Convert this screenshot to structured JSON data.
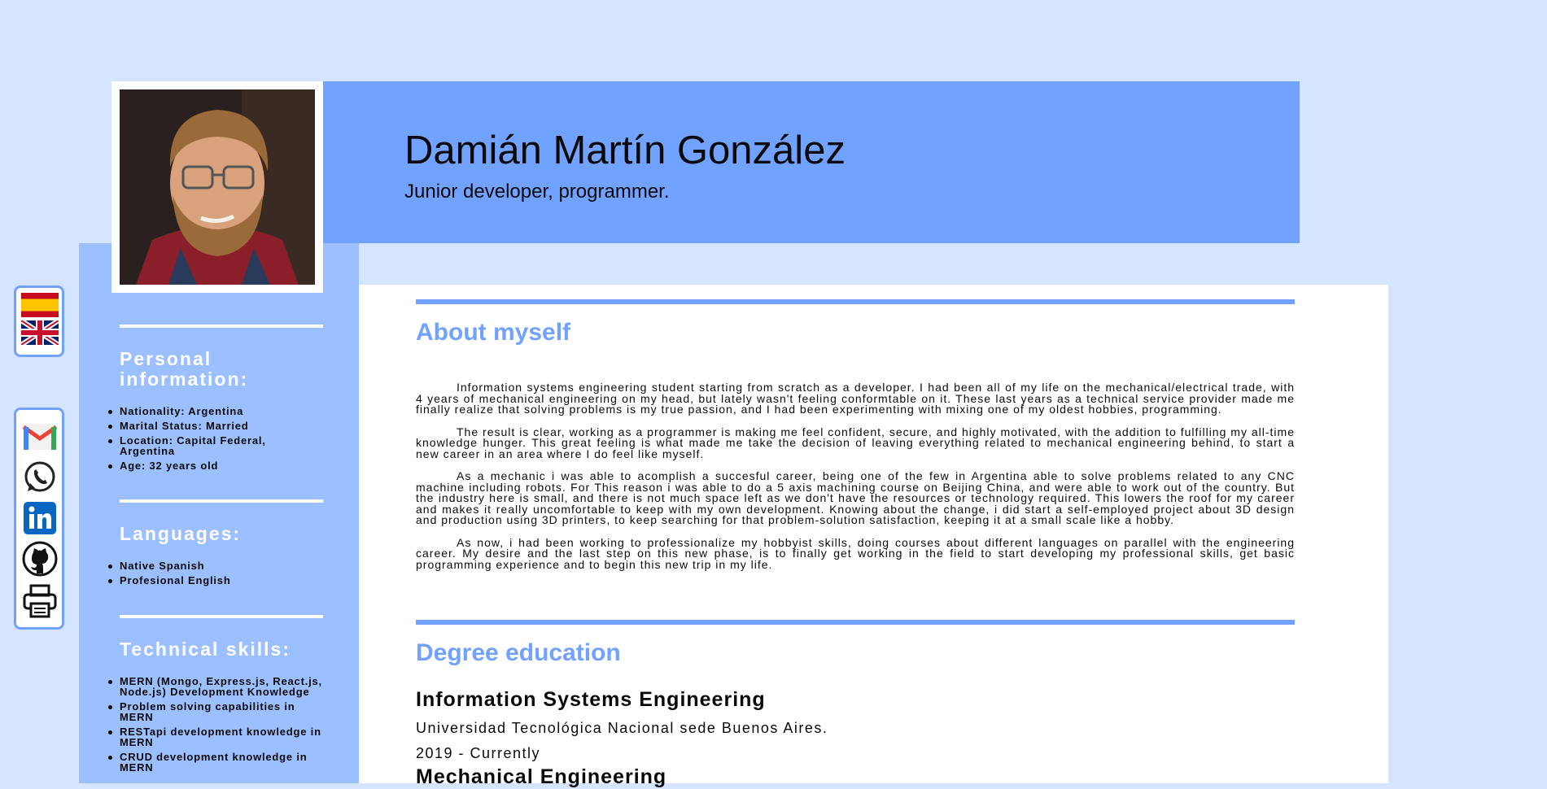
{
  "header": {
    "name": "Damián Martín González",
    "subtitle": "Junior developer, programmer."
  },
  "sidebar": {
    "personal": {
      "title": "Personal information:",
      "items": [
        "Nationality: Argentina",
        "Marital Status: Married",
        "Location: Capital Federal, Argentina",
        "Age: 32 years old"
      ]
    },
    "languages": {
      "title": "Languages:",
      "items": [
        "Native Spanish",
        "Profesional English"
      ]
    },
    "skills": {
      "title": "Technical skills:",
      "items": [
        "MERN (Mongo, Express.js, React.js, Node.js) Development Knowledge",
        "Problem solving capabilities in MERN",
        "RESTapi development knowledge in MERN",
        "CRUD development knowledge in MERN"
      ]
    }
  },
  "language_switcher": {
    "icons": [
      "spain-flag-icon",
      "uk-flag-icon"
    ]
  },
  "contact_links": {
    "icons": [
      "gmail-icon",
      "whatsapp-icon",
      "linkedin-icon",
      "github-icon",
      "printer-icon"
    ]
  },
  "about": {
    "title": "About myself",
    "paragraphs": [
      "Information systems engineering student starting from scratch as a developer. I had been all of my life on the mechanical/electrical trade, with 4 years of mechanical engineering on my head, but lately wasn't feeling conformtable on it. These last years as a technical service provider made me finally realize that solving problems is my true passion, and I had been experimenting with mixing one of my oldest hobbies, programming.",
      "The result is clear, working as a programmer is making me feel confident, secure, and highly motivated, with the addition to fulfilling my all-time knowledge hunger. This great feeling is what made me take the decision of leaving everything related to mechanical engineering behind, to start a new career in an area where I do feel like myself.",
      "As a mechanic i was able to acomplish a succesful career, being one of the few in Argentina able to solve problems related to any CNC machine including robots. For This reason i was able to do a 5 axis machining course on Beijing China, and were able to work out of the country. But the industry here is small, and there is not much space left as we don't have the resources or technology required. This lowers the roof for my career and makes it really uncomfortable to keep with my own development. Knowing about the change, i did start a self-employed project about 3D design and production using 3D printers, to keep searching for that problem-solution satisfaction, keeping it at a small scale like a hobby.",
      "As now, i had been working to professionalize my hobbyist skills, doing courses about different languages on parallel with the engineering career. My desire and the last step on this new phase, is to finally get working in the field to start developing my professional skills, get basic programming experience and to begin this new trip in my life."
    ]
  },
  "education": {
    "title": "Degree education",
    "degrees": [
      {
        "name": "Information Systems Engineering",
        "school": "Universidad Tecnológica Nacional sede Buenos Aires.",
        "dates": "2019 - Currently"
      },
      {
        "name": "Mechanical Engineering"
      }
    ]
  },
  "colors": {
    "page_bg": "#d5e4ff",
    "accent": "#72a2ff",
    "sidebar_bg": "#9cc0ff"
  }
}
